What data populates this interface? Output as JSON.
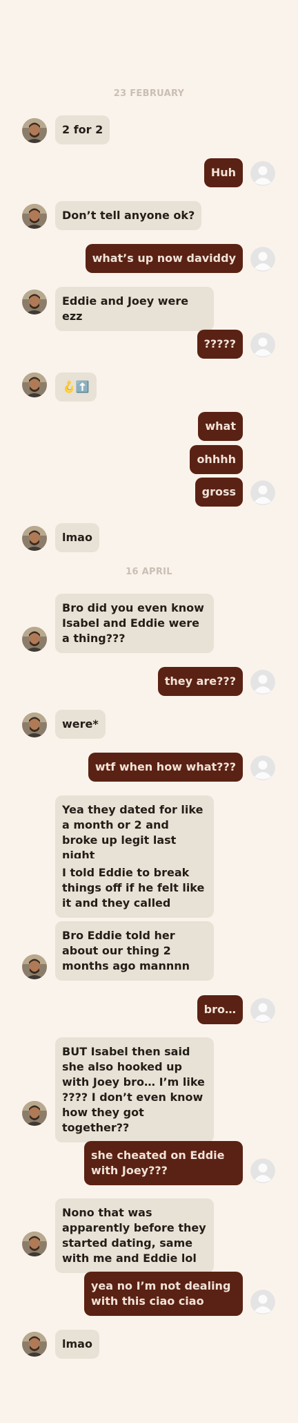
{
  "dates": [
    "23 FEBRUARY",
    "16 APRIL"
  ],
  "messages": [
    {
      "dir": "in",
      "text": "2 for 2"
    },
    {
      "dir": "out",
      "text": "Huh"
    },
    {
      "dir": "in",
      "text": "Don’t tell anyone ok?"
    },
    {
      "dir": "out",
      "text": "what’s up now daviddy"
    },
    {
      "dir": "in",
      "text": "Eddie and Joey were ezz"
    },
    {
      "dir": "out",
      "text": "?????"
    },
    {
      "dir": "in",
      "text": "🪝⬆️"
    },
    {
      "dir": "out",
      "text": "what"
    },
    {
      "dir": "out",
      "text": "ohhhh"
    },
    {
      "dir": "out",
      "text": "gross"
    },
    {
      "dir": "in",
      "text": "lmao"
    },
    {
      "dir": "in",
      "text": "Bro did you even know Isabel and Eddie were a thing???"
    },
    {
      "dir": "out",
      "text": "they are???"
    },
    {
      "dir": "in",
      "text": "were*"
    },
    {
      "dir": "out",
      "text": "wtf when how what???"
    },
    {
      "dir": "in",
      "text": "Yea they dated for like a month or 2 and broke up legit last night"
    },
    {
      "dir": "in",
      "text": "I told Eddie to break things off if he felt like it and they called"
    },
    {
      "dir": "in",
      "text": "Bro Eddie told her about our thing 2 months ago mannnn"
    },
    {
      "dir": "out",
      "text": "bro…"
    },
    {
      "dir": "in",
      "text": "BUT Isabel then said she also hooked up with Joey bro… I’m like ???? I don’t even know how they got together??"
    },
    {
      "dir": "out",
      "text": "she cheated on Eddie with Joey???"
    },
    {
      "dir": "in",
      "text": "Nono that was apparently before they started dating, same with me and Eddie lol"
    },
    {
      "dir": "out",
      "text": "yea no I’m not dealing with this ciao ciao"
    },
    {
      "dir": "in",
      "text": "lmao"
    }
  ],
  "colors": {
    "background": "#faf3ec",
    "incoming_bubble": "#e8e1d5",
    "outgoing_bubble": "#5a2214",
    "date_text": "#c9bfb4"
  },
  "icons": {
    "contact_avatar": "contact-avatar-photo",
    "own_avatar": "default-user-avatar-icon"
  }
}
